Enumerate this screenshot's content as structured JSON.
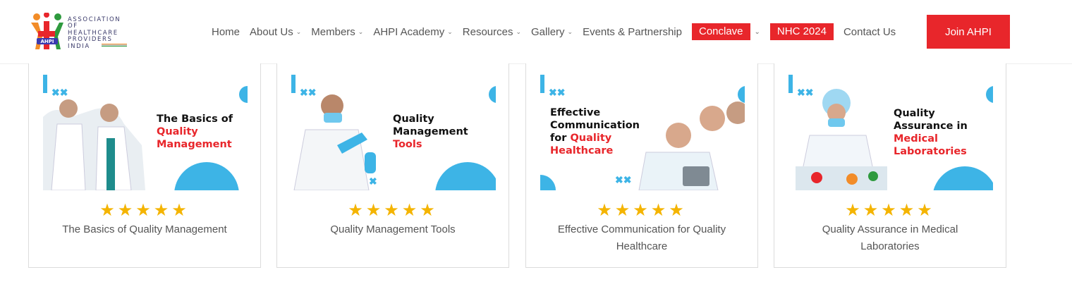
{
  "logo": {
    "badge_text": "AHPI",
    "lines": [
      "ASSOCIATION OF",
      "HEALTHCARE",
      "PROVIDERS",
      "INDIA"
    ]
  },
  "nav": {
    "items": [
      {
        "label": "Home",
        "dropdown": false
      },
      {
        "label": "About Us",
        "dropdown": true
      },
      {
        "label": "Members",
        "dropdown": true
      },
      {
        "label": "AHPI Academy",
        "dropdown": true
      },
      {
        "label": "Resources",
        "dropdown": true
      },
      {
        "label": "Gallery",
        "dropdown": true
      },
      {
        "label": "Events & Partnership",
        "dropdown": false
      }
    ],
    "conclave": "Conclave",
    "nhc": "NHC 2024",
    "contact": "Contact Us",
    "join": "Join AHPI"
  },
  "colors": {
    "accent_red": "#e8262b",
    "accent_blue": "#3db4e6",
    "star": "#f4b400"
  },
  "courses": [
    {
      "title": "The Basics of Quality Management",
      "banner_black": [
        "The Basics of"
      ],
      "banner_red": [
        "Quality",
        "Management"
      ],
      "rating": 5,
      "stars": "★★★★★"
    },
    {
      "title": "Quality Management Tools",
      "banner_black": [
        "Quality",
        "Management"
      ],
      "banner_red": [
        "Tools"
      ],
      "rating": 5,
      "stars": "★★★★★"
    },
    {
      "title": "Effective Communication for Quality Healthcare",
      "banner_black": [
        "Effective",
        "Communication",
        "for"
      ],
      "banner_red": [
        "Quality",
        "Healthcare"
      ],
      "rating": 5,
      "stars": "★★★★★"
    },
    {
      "title": "Quality Assurance in Medical Laboratories",
      "banner_black": [
        "Quality",
        "Assurance in"
      ],
      "banner_red": [
        "Medical",
        "Laboratories"
      ],
      "rating": 5,
      "stars": "★★★★★"
    }
  ]
}
